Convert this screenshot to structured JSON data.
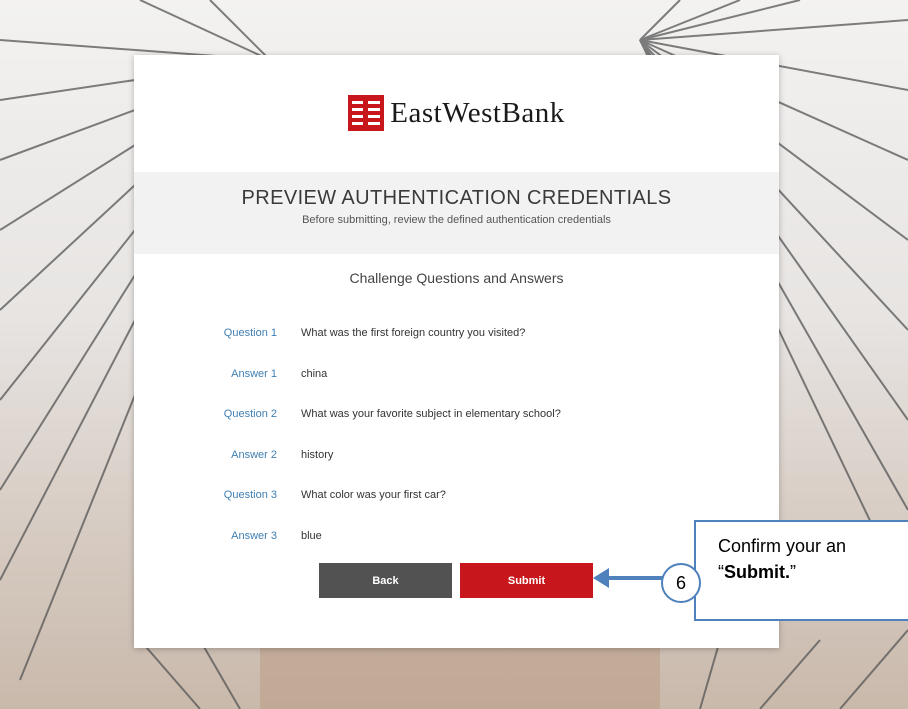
{
  "bank": {
    "logo_main": "EastWest",
    "logo_bank": "Bank"
  },
  "page": {
    "title": "PREVIEW AUTHENTICATION CREDENTIALS",
    "subtitle": "Before submitting, review the defined authentication credentials",
    "section_heading": "Challenge Questions and Answers"
  },
  "qa": [
    {
      "label": "Question 1",
      "value": "What was the first foreign country you visited?"
    },
    {
      "label": "Answer 1",
      "value": "china"
    },
    {
      "label": "Question 2",
      "value": "What was your favorite subject in elementary school?"
    },
    {
      "label": "Answer 2",
      "value": "history"
    },
    {
      "label": "Question 3",
      "value": "What color was your first car?"
    },
    {
      "label": "Answer 3",
      "value": "blue"
    }
  ],
  "buttons": {
    "back_label": "Back",
    "submit_label": "Submit"
  },
  "callout": {
    "step_number": "6",
    "line1": "Confirm your an",
    "line2_open": "“",
    "line2_bold": "Submit.",
    "line2_close": "”"
  },
  "colors": {
    "brand_red": "#c8171c",
    "link_blue": "#3f7fb3",
    "callout_blue": "#4f81bd"
  }
}
